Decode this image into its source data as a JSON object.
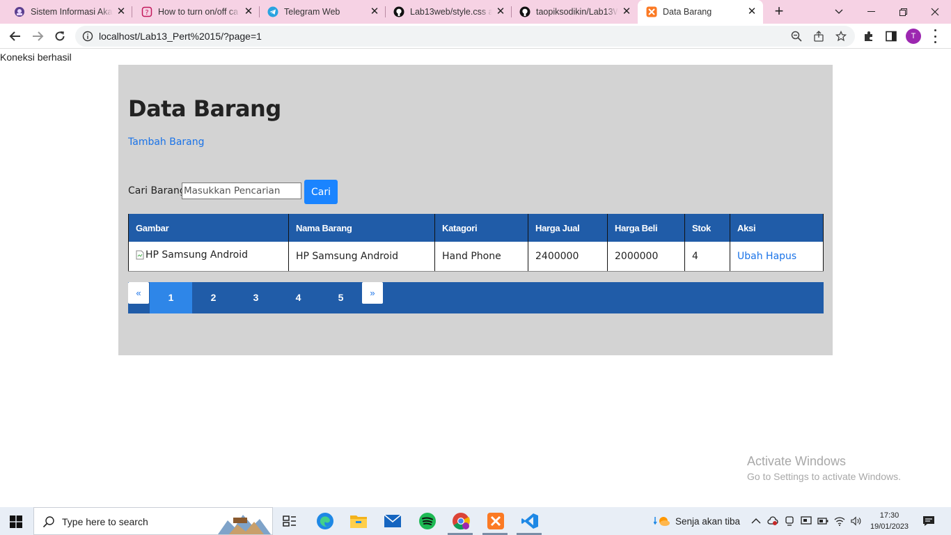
{
  "browser": {
    "tabs": [
      {
        "title": "Sistem Informasi Akad",
        "active": false
      },
      {
        "title": "How to turn on/off ca",
        "active": false
      },
      {
        "title": "Telegram Web",
        "active": false
      },
      {
        "title": "Lab13web/style.css at",
        "active": false
      },
      {
        "title": "taopiksodikin/Lab13W",
        "active": false
      },
      {
        "title": "Data Barang",
        "active": true
      }
    ],
    "url": "localhost/Lab13_Pert%2015/?page=1",
    "profile_initial": "T"
  },
  "page": {
    "connection_status": "Koneksi berhasil",
    "title": "Data Barang",
    "add_link": "Tambah Barang",
    "search": {
      "label": "Cari Barang",
      "placeholder": "Masukkan Pencarian",
      "button": "Cari"
    },
    "table": {
      "headers": [
        "Gambar",
        "Nama Barang",
        "Katagori",
        "Harga Jual",
        "Harga Beli",
        "Stok",
        "Aksi"
      ],
      "rows": [
        {
          "gambar_alt": "HP Samsung Android",
          "nama": "HP Samsung Android",
          "kategori": "Hand Phone",
          "harga_jual": "2400000",
          "harga_beli": "2000000",
          "stok": "4",
          "aksi_ubah": "Ubah",
          "aksi_hapus": "Hapus"
        }
      ]
    },
    "pagination": {
      "prev": "«",
      "pages": [
        "1",
        "2",
        "3",
        "4",
        "5"
      ],
      "current": "1",
      "next": "»"
    }
  },
  "watermark": {
    "line1": "Activate Windows",
    "line2": "Go to Settings to activate Windows."
  },
  "taskbar": {
    "search_placeholder": "Type here to search",
    "weather": "Senja akan tiba",
    "time": "17:30",
    "date": "19/01/2023"
  },
  "colors": {
    "tabbar": "#f6d2e4",
    "table_header": "#205ca8",
    "pager_active": "#2e86e8",
    "button": "#1a84ff",
    "link": "#1a73e8",
    "container": "#d3d3d3"
  }
}
